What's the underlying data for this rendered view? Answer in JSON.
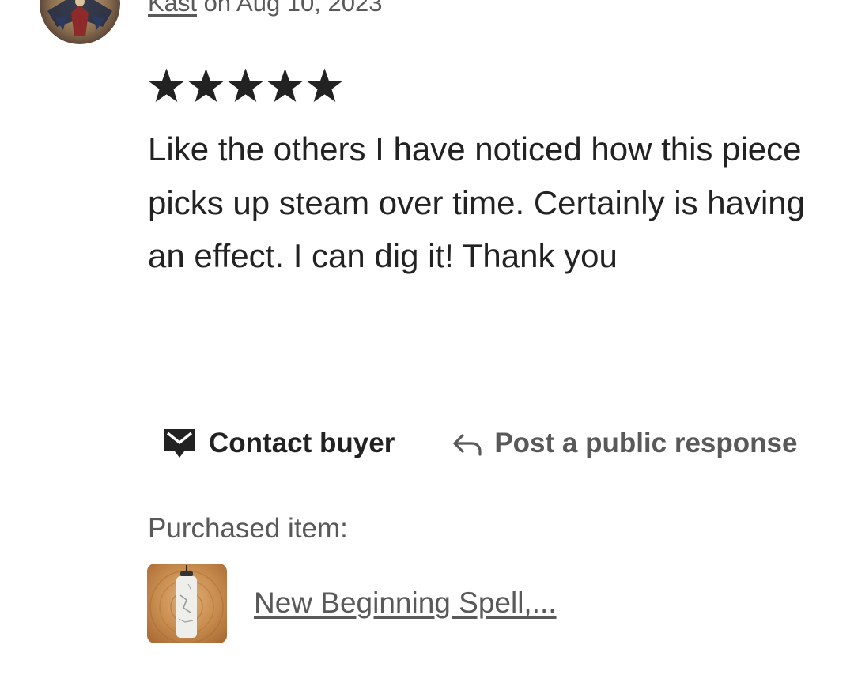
{
  "review": {
    "reviewer_name": "Kast",
    "date_text": " on Aug 10, 2023",
    "rating": 5,
    "rating_max": 5,
    "text": "Like the others I have noticed how this piece picks up steam over time. Certainly is having an effect. I can dig it! Thank you"
  },
  "actions": {
    "contact_label": "Contact buyer",
    "contact_icon": "mail-icon",
    "respond_label": "Post a public response",
    "respond_icon": "reply-arrow-icon"
  },
  "purchase": {
    "label": "Purchased item:",
    "item_title": "New Beginning Spell,...",
    "item_image": "pendant-thumbnail"
  },
  "colors": {
    "primary_text": "#222222",
    "secondary_text": "#595959",
    "background": "#ffffff"
  }
}
